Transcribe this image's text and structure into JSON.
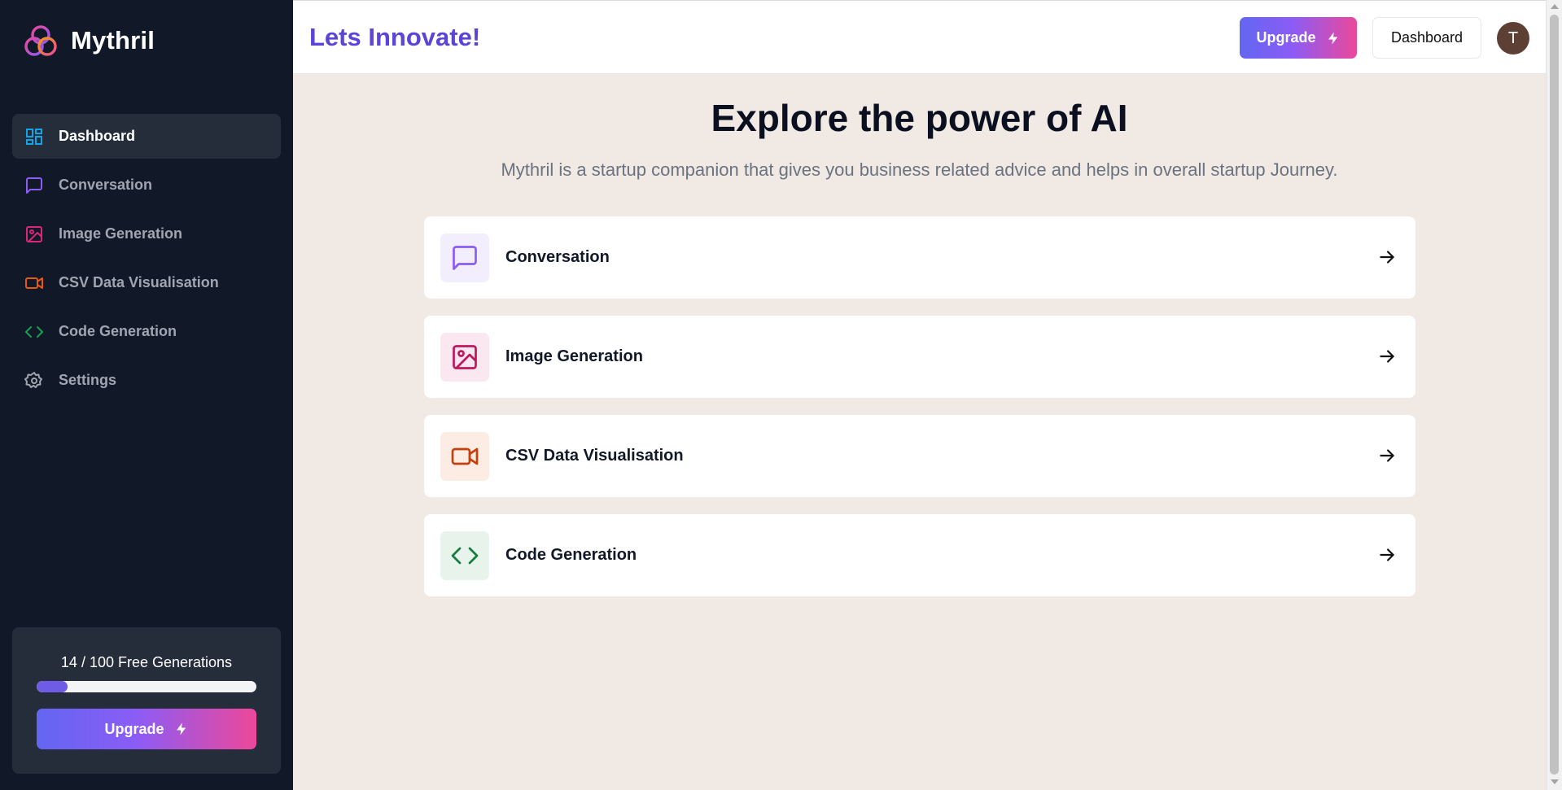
{
  "brand": {
    "name": "Mythril"
  },
  "sidebar": {
    "items": [
      {
        "label": "Dashboard",
        "icon": "dashboard-icon",
        "color": "#0ea5e9",
        "active": true
      },
      {
        "label": "Conversation",
        "icon": "message-square-icon",
        "color": "#8b5cf6",
        "active": false
      },
      {
        "label": "Image Generation",
        "icon": "image-icon",
        "color": "#db2777",
        "active": false
      },
      {
        "label": "CSV Data Visualisation",
        "icon": "video-icon",
        "color": "#ea580c",
        "active": false
      },
      {
        "label": "Code Generation",
        "icon": "code-icon",
        "color": "#16a34a",
        "active": false
      },
      {
        "label": "Settings",
        "icon": "settings-icon",
        "color": "#a0a6b1",
        "active": false
      }
    ]
  },
  "usage": {
    "text": "14 / 100 Free Generations",
    "used": 14,
    "limit": 100,
    "upgrade_label": "Upgrade"
  },
  "header": {
    "title": "Lets Innovate!",
    "upgrade_label": "Upgrade",
    "dashboard_label": "Dashboard",
    "avatar_initial": "T"
  },
  "main": {
    "title": "Explore the power of AI",
    "subtitle": "Mythril is a startup companion that gives you business related advice and helps in overall startup Journey.",
    "tools": [
      {
        "label": "Conversation",
        "icon": "message-square-icon",
        "color": "#8b5cf6",
        "bg": "#f3eefe"
      },
      {
        "label": "Image Generation",
        "icon": "image-icon",
        "color": "#be185d",
        "bg": "#fbe7ef"
      },
      {
        "label": "CSV Data Visualisation",
        "icon": "video-icon",
        "color": "#c2410c",
        "bg": "#fcece4"
      },
      {
        "label": "Code Generation",
        "icon": "code-icon",
        "color": "#15803d",
        "bg": "#e8f3ec"
      }
    ]
  },
  "colors": {
    "sidebar_bg": "#111827",
    "accent": "#5b45d9",
    "main_bg": "#f1e9e3"
  }
}
